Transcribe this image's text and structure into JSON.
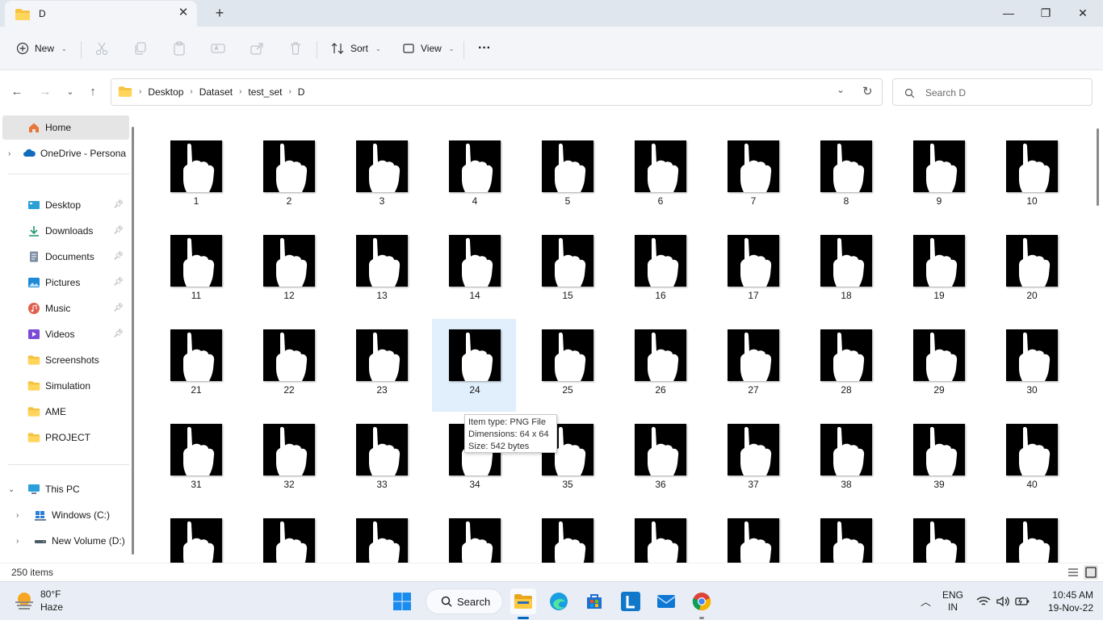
{
  "window": {
    "tab_title": "D",
    "minimize_glyph": "—",
    "restore_glyph": "❐",
    "close_glyph": "✕"
  },
  "toolbar": {
    "new_label": "New",
    "sort_label": "Sort",
    "view_label": "View",
    "more_label": "···"
  },
  "address": {
    "breadcrumbs": [
      "Desktop",
      "Dataset",
      "test_set",
      "D"
    ]
  },
  "search": {
    "placeholder": "Search D"
  },
  "sidebar": {
    "home": "Home",
    "onedrive": "OneDrive - Persona",
    "quick_access": [
      {
        "label": "Desktop",
        "icon": "desktop-icon",
        "pinned": true
      },
      {
        "label": "Downloads",
        "icon": "download-icon",
        "pinned": true
      },
      {
        "label": "Documents",
        "icon": "documents-icon",
        "pinned": true
      },
      {
        "label": "Pictures",
        "icon": "pictures-icon",
        "pinned": true
      },
      {
        "label": "Music",
        "icon": "music-icon",
        "pinned": true
      },
      {
        "label": "Videos",
        "icon": "videos-icon",
        "pinned": true
      },
      {
        "label": "Screenshots",
        "icon": "folder-icon",
        "pinned": false
      },
      {
        "label": "Simulation",
        "icon": "folder-icon",
        "pinned": false
      },
      {
        "label": "AME",
        "icon": "folder-icon",
        "pinned": false
      },
      {
        "label": "PROJECT",
        "icon": "folder-icon",
        "pinned": false
      }
    ],
    "this_pc": "This PC",
    "drives": [
      "Windows (C:)",
      "New Volume (D:)"
    ]
  },
  "files": {
    "visible_labels": [
      "1",
      "2",
      "3",
      "4",
      "5",
      "6",
      "7",
      "8",
      "9",
      "10",
      "11",
      "12",
      "13",
      "14",
      "15",
      "16",
      "17",
      "18",
      "19",
      "20",
      "21",
      "22",
      "23",
      "24",
      "25",
      "26",
      "27",
      "28",
      "29",
      "30",
      "31",
      "32",
      "33",
      "34",
      "35",
      "36",
      "37",
      "38",
      "39",
      "40",
      "",
      "",
      "",
      "",
      "",
      "",
      "",
      "",
      "",
      ""
    ],
    "selected_label": "24"
  },
  "tooltip": {
    "item_type": "Item type: PNG File",
    "dimensions": "Dimensions: 64 x 64",
    "size": "Size: 542 bytes"
  },
  "status": {
    "item_count": "250 items"
  },
  "taskbar": {
    "weather_temp": "80°F",
    "weather_desc": "Haze",
    "search_label": "Search",
    "lang_top": "ENG",
    "lang_bottom": "IN",
    "time": "10:45 AM",
    "date": "19-Nov-22"
  }
}
